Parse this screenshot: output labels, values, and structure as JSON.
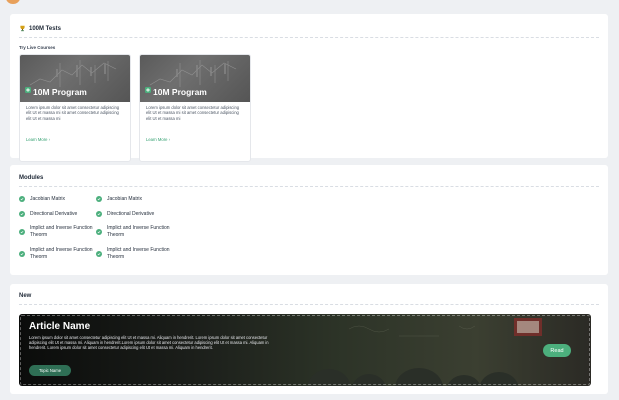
{
  "tests_section": {
    "title": "100M Tests",
    "subtitle": "Try Live Courses",
    "courses": [
      {
        "name": "10M Program",
        "description": "Lorem ipsum dolor sit amet consectetur adipiscing elit Ut et massa mi sit amet consectetur adipiscing elit Ut et massa mi",
        "link": "Learn More  ›"
      },
      {
        "name": "10M Program",
        "description": "Lorem ipsum dolor sit amet consectetur adipiscing elit Ut et massa mi sit amet consectetur adipiscing elit Ut et massa mi",
        "link": "Learn More  ›"
      }
    ]
  },
  "modules_section": {
    "title": "Modules",
    "left": [
      "Jacobian Matrix",
      "Directional Derivative",
      "Implict and Inverse Function Theorm",
      "Implict and Inverse Function Theorm"
    ],
    "right": [
      "Jacobian Matrix",
      "Directional Derivative",
      "Implict and Inverse Function Theorm",
      "Implict and Inverse Function Theorm"
    ]
  },
  "new_section": {
    "title": "New",
    "article": {
      "title": "Article Name",
      "body": "Lorem ipsum dolor sit amet consectetur adipiscing elit Ut et massa mi. Aliquam in hendrerit. Lorem ipsum dolor sit amet consectetur adipiscing elit Ut et massa mi. Aliquam in hendrerit.Lorem ipsum dolor sit amet consectetur adipiscing elit Ut et massa mi. Aliquam in hendrerit. Lorem ipsum dolor sit amet consectetur adipiscing elit Ut et massa mi. Aliquam in hendrerit.",
      "topic_label": "Topic Name",
      "read_label": "Read"
    }
  },
  "colors": {
    "accent_green": "#4caf7d",
    "dark_green": "#2f6f55",
    "page_bg": "#eef0f3"
  },
  "icons": [
    "trophy-icon",
    "check-icon",
    "program-badge-icon"
  ]
}
